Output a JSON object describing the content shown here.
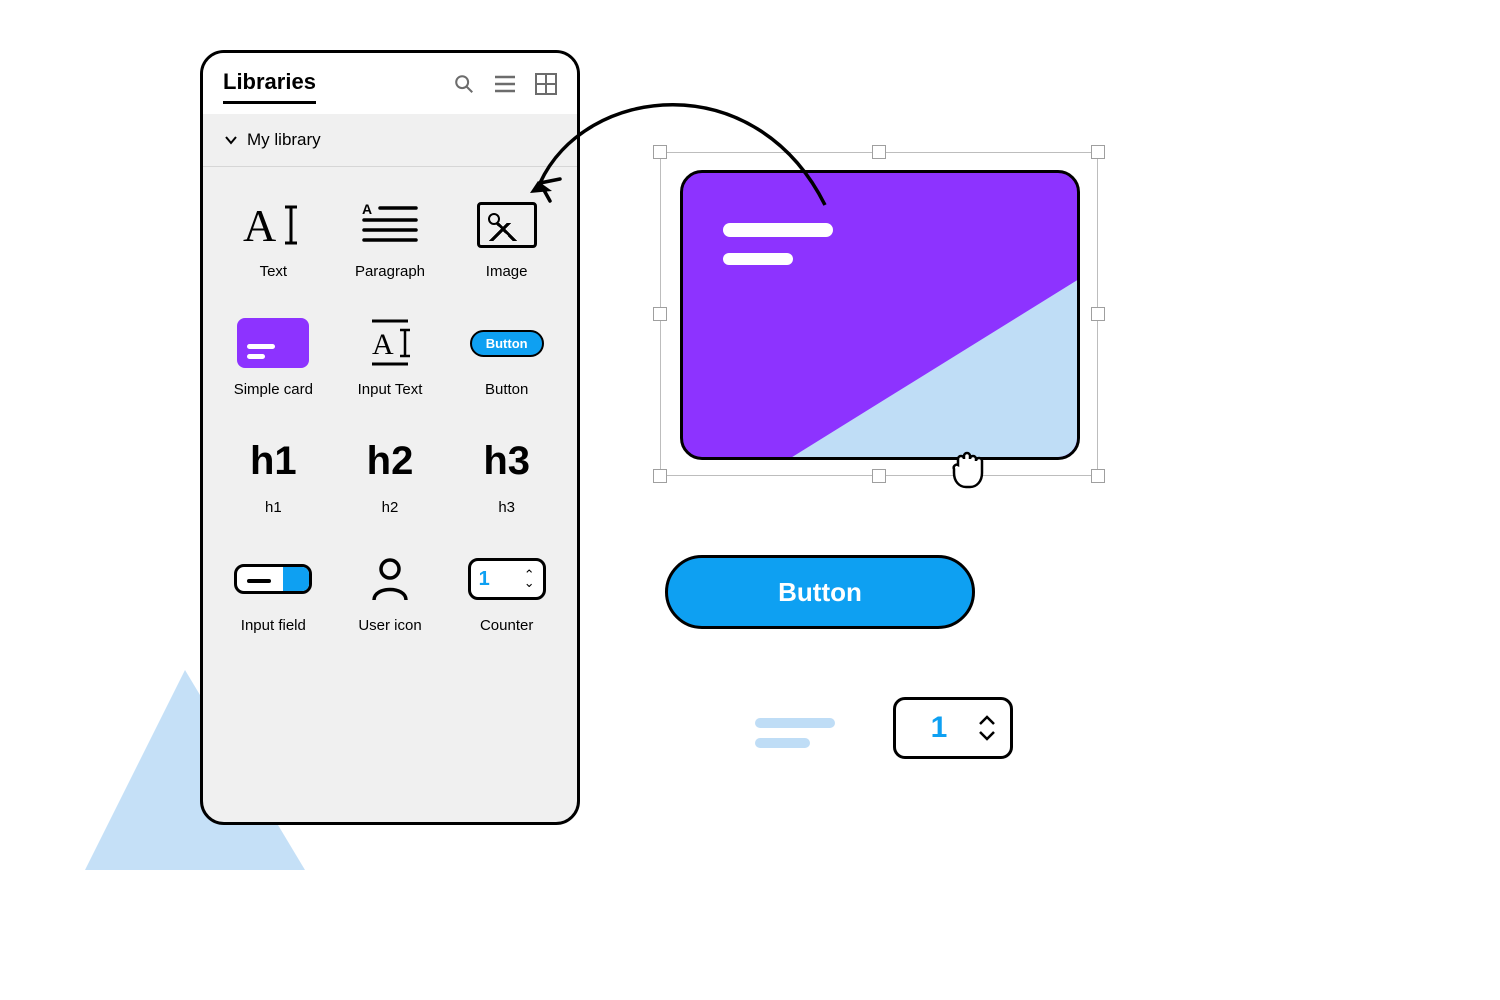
{
  "panel": {
    "title": "Libraries",
    "section": "My library",
    "items": [
      {
        "label": "Text"
      },
      {
        "label": "Paragraph"
      },
      {
        "label": "Image"
      },
      {
        "label": "Simple card"
      },
      {
        "label": "Input Text"
      },
      {
        "label": "Button",
        "pill_text": "Button"
      },
      {
        "label": "h1",
        "glyph": "h1"
      },
      {
        "label": "h2",
        "glyph": "h2"
      },
      {
        "label": "h3",
        "glyph": "h3"
      },
      {
        "label": "Input field"
      },
      {
        "label": "User icon"
      },
      {
        "label": "Counter",
        "value": "1"
      }
    ]
  },
  "canvas": {
    "big_button_label": "Button",
    "counter_value": "1"
  },
  "colors": {
    "accent_purple": "#8d33ff",
    "accent_blue": "#0ea0f2",
    "light_blue": "#bfddf6"
  }
}
